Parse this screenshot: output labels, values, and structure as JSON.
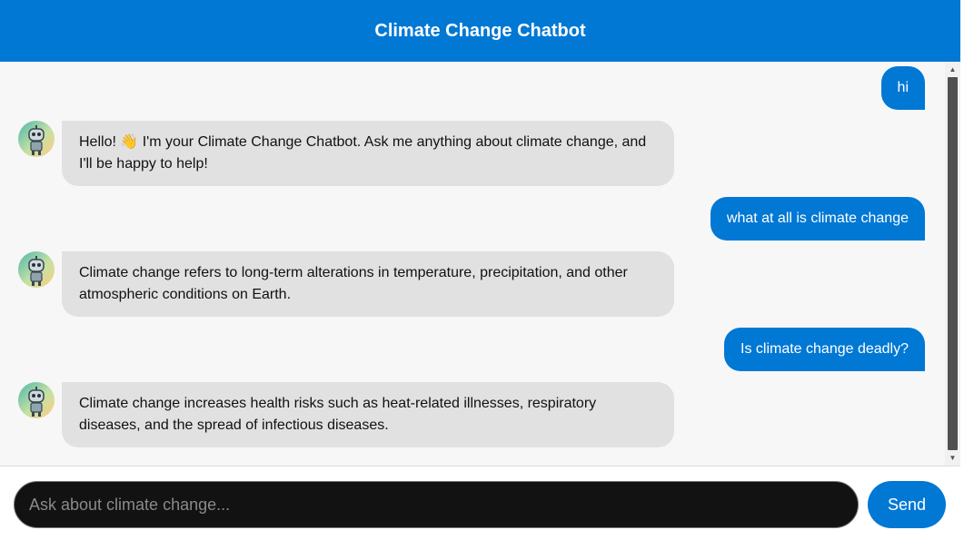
{
  "header": {
    "title": "Climate Change Chatbot"
  },
  "messages": [
    {
      "sender": "user",
      "text": "hi"
    },
    {
      "sender": "bot",
      "text": "Hello! 👋 I'm your Climate Change Chatbot. Ask me anything about climate change, and I'll be happy to help!"
    },
    {
      "sender": "user",
      "text": "what at all is climate change"
    },
    {
      "sender": "bot",
      "text": "Climate change refers to long-term alterations in temperature, precipitation, and other atmospheric conditions on Earth."
    },
    {
      "sender": "user",
      "text": "Is climate change deadly?"
    },
    {
      "sender": "bot",
      "text": "Climate change increases health risks such as heat-related illnesses, respiratory diseases, and the spread of infectious diseases."
    }
  ],
  "input": {
    "placeholder": "Ask about climate change...",
    "value": ""
  },
  "send_label": "Send",
  "colors": {
    "accent": "#0078d4",
    "bot_bubble": "#e1e1e1",
    "chat_bg": "#f7f7f7"
  }
}
